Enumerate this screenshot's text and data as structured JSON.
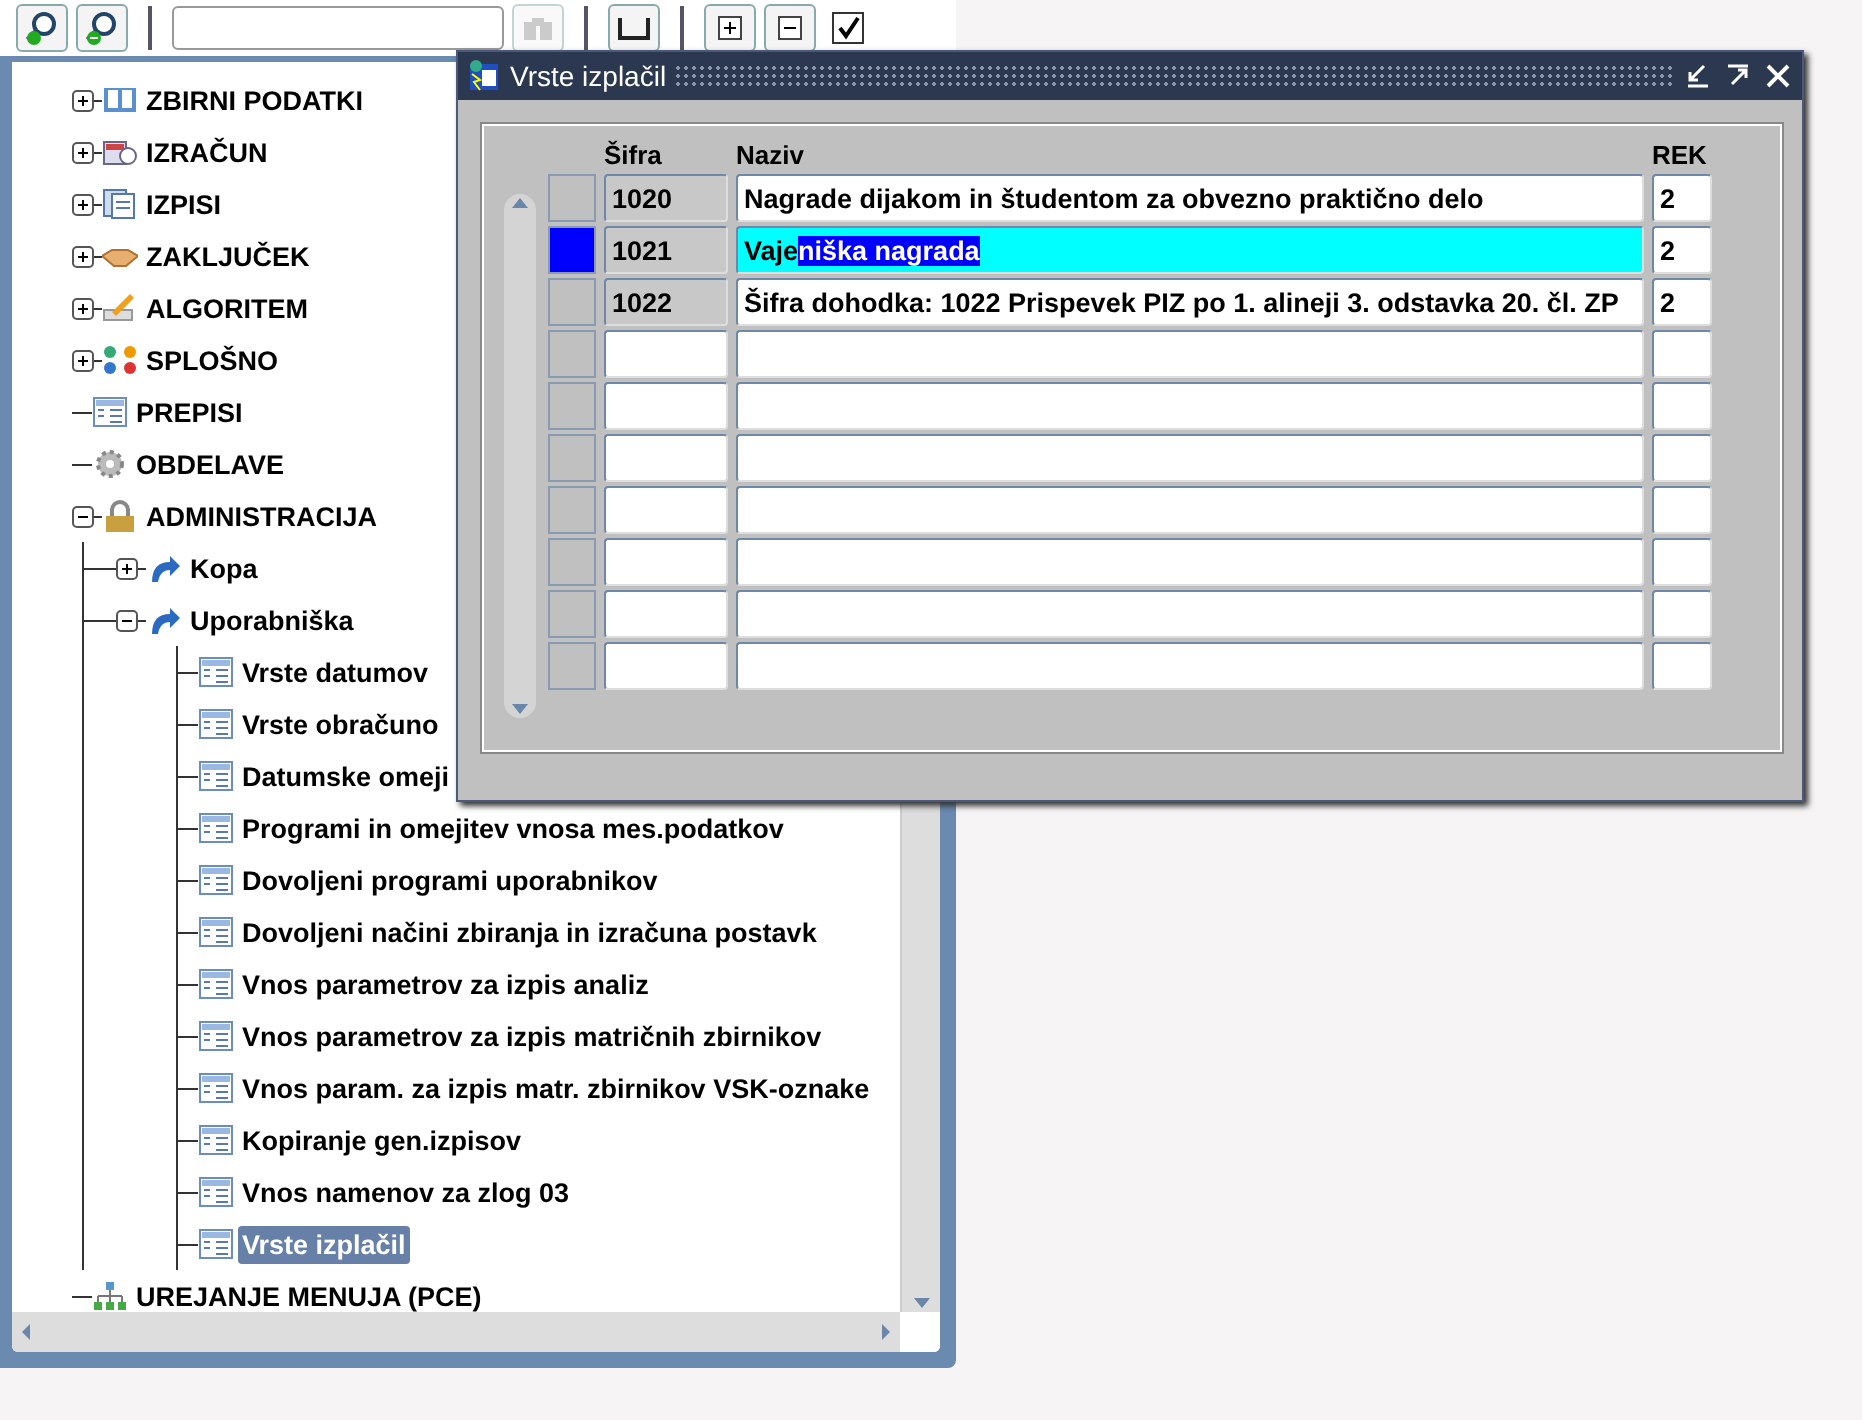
{
  "toolbar": {
    "checkbox": {
      "checked": true
    }
  },
  "tree": [
    {
      "label": "ZBIRNI PODATKI",
      "kind": "book",
      "expanded": false,
      "selected": false
    },
    {
      "label": "IZRAČUN",
      "kind": "calendar",
      "expanded": false,
      "selected": false
    },
    {
      "label": "IZPISI",
      "kind": "pages",
      "expanded": false,
      "selected": false
    },
    {
      "label": "ZAKLJUČEK",
      "kind": "handshake",
      "expanded": false,
      "selected": false
    },
    {
      "label": "ALGORITEM",
      "kind": "pen",
      "expanded": false,
      "selected": false
    },
    {
      "label": "SPLOŠNO",
      "kind": "dots",
      "expanded": false,
      "selected": false
    },
    {
      "label": "PREPISI",
      "kind": "form",
      "selected": false
    },
    {
      "label": "OBDELAVE",
      "kind": "gear",
      "selected": false
    },
    {
      "label": "ADMINISTRACIJA",
      "kind": "lock",
      "expanded": true,
      "selected": false,
      "children": [
        {
          "label": "Kopa",
          "kind": "arrow",
          "expanded": false,
          "selected": false
        },
        {
          "label": "Uporabniška",
          "kind": "arrow",
          "expanded": true,
          "selected": false,
          "children": [
            {
              "label": "Vrste datumov",
              "kind": "form",
              "selected": false
            },
            {
              "label": "Vrste obračuno",
              "kind": "form",
              "selected": false
            },
            {
              "label": "Datumske omeji",
              "kind": "form",
              "selected": false
            },
            {
              "label": "Programi in omejitev vnosa mes.podatkov",
              "kind": "form",
              "selected": false
            },
            {
              "label": "Dovoljeni programi uporabnikov",
              "kind": "form",
              "selected": false
            },
            {
              "label": "Dovoljeni načini zbiranja in izračuna postavk",
              "kind": "form",
              "selected": false
            },
            {
              "label": "Vnos parametrov za izpis analiz",
              "kind": "form",
              "selected": false
            },
            {
              "label": "Vnos parametrov za izpis matričnih zbirnikov",
              "kind": "form",
              "selected": false
            },
            {
              "label": "Vnos param. za izpis matr. zbirnikov VSK-oznake",
              "kind": "form",
              "selected": false
            },
            {
              "label": "Kopiranje gen.izpisov",
              "kind": "form",
              "selected": false
            },
            {
              "label": "Vnos namenov za zlog 03",
              "kind": "form",
              "selected": false
            },
            {
              "label": "Vrste izplačil",
              "kind": "form",
              "selected": true
            }
          ]
        }
      ]
    },
    {
      "label": "UREJANJE MENUJA (PCE)",
      "kind": "network",
      "selected": false
    }
  ],
  "dialog": {
    "title": "Vrste izplačil",
    "columns": [
      "Šifra",
      "Naziv",
      "REK"
    ],
    "rows": [
      {
        "sifra": "1020",
        "naziv": "Nagrade dijakom in študentom za obvezno praktično delo",
        "rek": "2",
        "selected": false
      },
      {
        "sifra": "1021",
        "naziv": "Vaje",
        "naziv_selected_text": "niška nagrada",
        "rek": "2",
        "selected": true
      },
      {
        "sifra": "1022",
        "naziv": "Šifra dohodka: 1022 Prispevek PIZ po 1. alineji 3. odstavka 20. čl. ZP",
        "rek": "2",
        "selected": false
      },
      {
        "selected": false
      },
      {
        "selected": false
      },
      {
        "selected": false
      },
      {
        "selected": false
      },
      {
        "selected": false
      },
      {
        "selected": false
      },
      {
        "selected": false
      }
    ]
  }
}
